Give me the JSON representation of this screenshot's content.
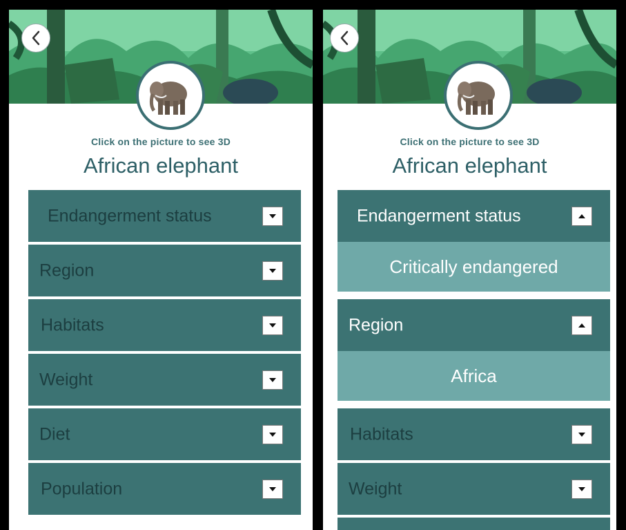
{
  "colors": {
    "accordion_header": "#3c7373",
    "accordion_content": "#6fa9a8",
    "title_text": "#2d5f66",
    "frame": "#000000"
  },
  "icons": {
    "back": "chevron-left-icon",
    "expand": "triangle-down-icon",
    "collapse": "triangle-up-icon",
    "animal": "elephant-image"
  },
  "screens": [
    {
      "hint": "Click on the picture to see 3D",
      "title": "African elephant",
      "sections": [
        {
          "label": "Endangerment status",
          "expanded": false
        },
        {
          "label": "Region",
          "expanded": false
        },
        {
          "label": "Habitats",
          "expanded": false
        },
        {
          "label": "Weight",
          "expanded": false
        },
        {
          "label": "Diet",
          "expanded": false
        },
        {
          "label": "Population",
          "expanded": false
        }
      ]
    },
    {
      "hint": "Click on the picture to see 3D",
      "title": "African elephant",
      "sections": [
        {
          "label": "Endangerment status",
          "expanded": true,
          "value": "Critically endangered"
        },
        {
          "label": "Region",
          "expanded": true,
          "value": "Africa"
        },
        {
          "label": "Habitats",
          "expanded": false
        },
        {
          "label": "Weight",
          "expanded": false
        },
        {
          "label": "",
          "expanded": false
        }
      ]
    }
  ]
}
